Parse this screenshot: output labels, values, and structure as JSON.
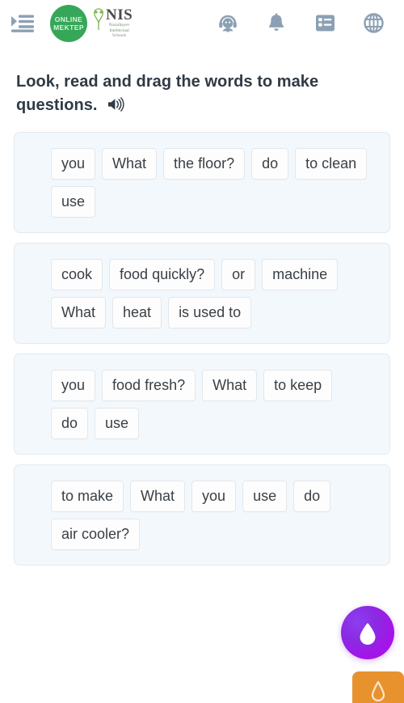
{
  "header": {
    "menu_icon": "menu-indent-icon",
    "logo_online_mektep_line1": "ONLINE",
    "logo_online_mektep_line2": "MEKTEP",
    "logo_nis_main": "NIS",
    "logo_nis_sub_line1": "Nazarbayev",
    "logo_nis_sub_line2": "Intellectual",
    "logo_nis_sub_line3": "Schools",
    "icons": [
      {
        "name": "support-agent-icon"
      },
      {
        "name": "notifications-bell-icon"
      },
      {
        "name": "task-list-icon"
      },
      {
        "name": "language-globe-icon"
      }
    ],
    "icon_color": "#8ca0b3",
    "brand_green": "#36a758"
  },
  "task": {
    "title_line1": "Look, read and drag the words to make",
    "title_line2": "questions.",
    "audio_icon": "speaker-icon"
  },
  "groups": [
    {
      "id": "question-1",
      "words": [
        "you",
        "What",
        "the floor?",
        "do",
        "to clean",
        "use"
      ]
    },
    {
      "id": "question-2",
      "words": [
        "cook",
        "food quickly?",
        "or",
        "machine",
        "What",
        "heat",
        "is used to"
      ]
    },
    {
      "id": "question-3",
      "words": [
        "you",
        "food fresh?",
        "What",
        "to keep",
        "do",
        "use"
      ]
    },
    {
      "id": "question-4",
      "words": [
        "to make",
        "What",
        "you",
        "use",
        "do",
        "air cooler?"
      ]
    }
  ],
  "assistant": {
    "fab_icon": "alice-assistant-icon",
    "fab_color": "#9b1de0",
    "badge_icon": "alice-triangle-icon",
    "badge_color": "#e8922e"
  }
}
